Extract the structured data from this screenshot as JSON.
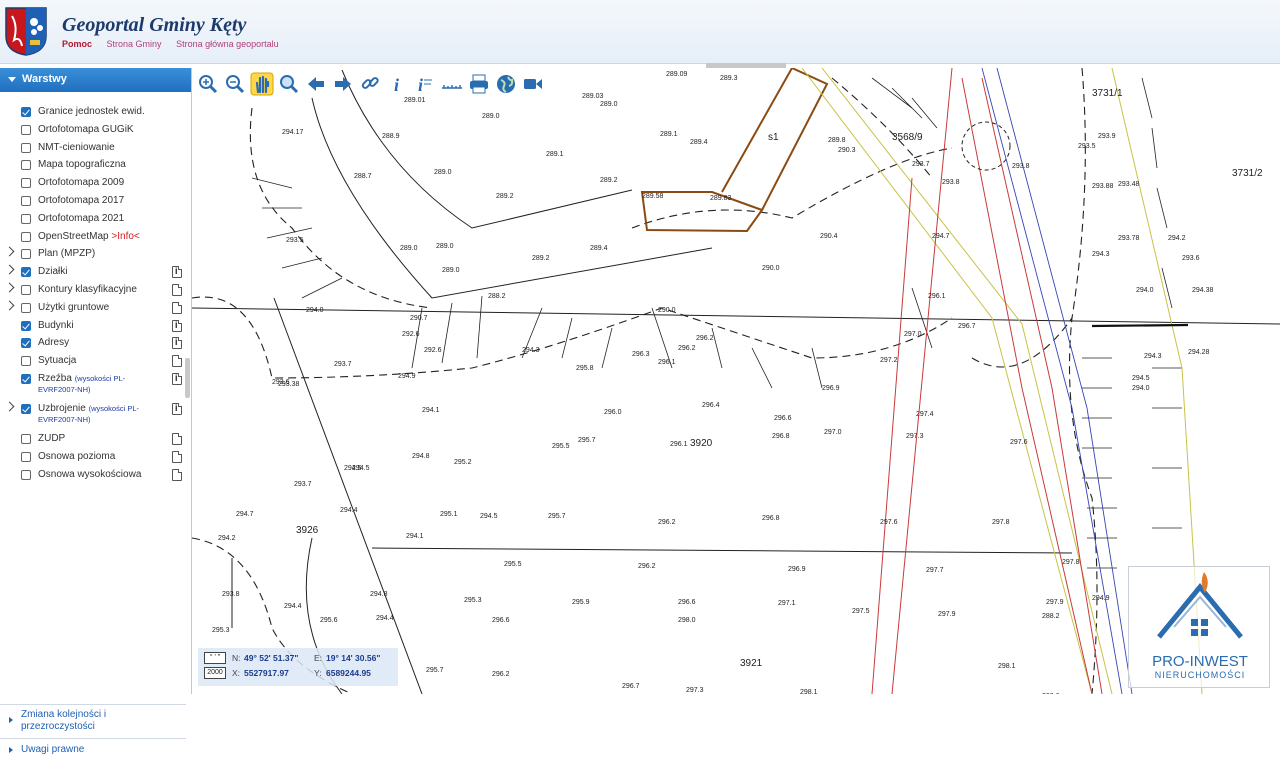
{
  "header": {
    "title": "Geoportal Gminy Kęty",
    "links": [
      "Pomoc",
      "Strona Gminy",
      "Strona główna geoportalu"
    ]
  },
  "sidebar": {
    "panel_title": "Warstwy",
    "layers": [
      {
        "label": "Granice jednostek ewid.",
        "checked": true,
        "expandable": false,
        "icon": null
      },
      {
        "label": "Ortofotomapa GUGiK",
        "checked": false,
        "expandable": false,
        "icon": null
      },
      {
        "label": "NMT-cieniowanie",
        "checked": false,
        "expandable": false,
        "icon": null
      },
      {
        "label": "Mapa topograficzna",
        "checked": false,
        "expandable": false,
        "icon": null
      },
      {
        "label": "Ortofotomapa 2009",
        "checked": false,
        "expandable": false,
        "icon": null
      },
      {
        "label": "Ortofotomapa 2017",
        "checked": false,
        "expandable": false,
        "icon": null
      },
      {
        "label": "Ortofotomapa 2021",
        "checked": false,
        "expandable": false,
        "icon": null
      },
      {
        "label": "OpenStreetMap",
        "extra": ">Info<",
        "checked": false,
        "expandable": false,
        "icon": null
      },
      {
        "label": "Plan (MPZP)",
        "checked": false,
        "expandable": true,
        "icon": null
      },
      {
        "label": "Działki",
        "checked": true,
        "expandable": true,
        "icon": "info-doc-icon"
      },
      {
        "label": "Kontury klasyfikacyjne",
        "checked": false,
        "expandable": true,
        "icon": "doc-icon"
      },
      {
        "label": "Użytki gruntowe",
        "checked": false,
        "expandable": true,
        "icon": "doc-icon"
      },
      {
        "label": "Budynki",
        "checked": true,
        "expandable": false,
        "icon": "info-doc-icon"
      },
      {
        "label": "Adresy",
        "checked": true,
        "expandable": false,
        "icon": "info-doc-icon"
      },
      {
        "label": "Sytuacja",
        "checked": false,
        "expandable": false,
        "icon": "doc-icon"
      },
      {
        "label": "Rzeźba",
        "sub": "(wysokości PL-EVRF2007-NH)",
        "checked": true,
        "expandable": false,
        "icon": "info-doc-icon"
      },
      {
        "label": "Uzbrojenie",
        "sub": "(wysokości PL-EVRF2007-NH)",
        "checked": true,
        "expandable": true,
        "icon": "info-doc-icon"
      },
      {
        "label": "ZUDP",
        "checked": false,
        "expandable": false,
        "icon": "doc-icon"
      },
      {
        "label": "Osnowa pozioma",
        "checked": false,
        "expandable": false,
        "icon": "doc-icon"
      },
      {
        "label": "Osnowa wysokościowa",
        "checked": false,
        "expandable": false,
        "icon": "doc-icon"
      }
    ],
    "order_panel": "Zmiana kolejności i przezroczystości",
    "legal_panel": "Uwagi prawne"
  },
  "toolbar": [
    "zoom-in-icon",
    "zoom-out-icon",
    "pan-hand-icon",
    "zoom-box-icon",
    "back-arrow-icon",
    "forward-arrow-icon",
    "link-icon",
    "info-icon",
    "info-query-icon",
    "measure-icon",
    "print-icon",
    "globe-icon",
    "video-icon"
  ],
  "coords": {
    "system_a": "° ' \"",
    "system_b": "2000",
    "n_label": "N:",
    "n_value": "49° 52' 51.37\"",
    "e_label": "E:",
    "e_value": "19° 14' 30.56\"",
    "x_label": "X:",
    "x_value": "5527917.97",
    "y_label": "Y:",
    "y_value": "6589244.95"
  },
  "map": {
    "parcels": [
      "3920",
      "3926",
      "3921",
      "3568/9",
      "3731/1",
      "3731/2",
      "s1",
      "3568/9.293.3"
    ],
    "heights": [
      "289.09",
      "289.3",
      "289.01",
      "289.03",
      "289.0",
      "289.0",
      "294.17",
      "288.9",
      "289.1",
      "289.4",
      "289.8",
      "290.3",
      "293.7",
      "288.7",
      "289.0",
      "289.1",
      "289.2",
      "289.58",
      "289.83",
      "293.8",
      "294.7",
      "289.0",
      "289.2",
      "289.4",
      "290.4",
      "293.5",
      "289.0",
      "289.0",
      "289.2",
      "290.0",
      "294.0",
      "288.2",
      "294.3",
      "290.7",
      "290.0",
      "296.1",
      "292.6",
      "292.6",
      "296.2",
      "296.2",
      "297.0",
      "294.5",
      "296.3",
      "296.7",
      "293.7",
      "294.9",
      "295.8",
      "296.1",
      "297.2",
      "293.6",
      "296.9",
      "294.1",
      "296.4",
      "296.0",
      "295.7",
      "296.6",
      "297.4",
      "295.5",
      "296.1",
      "296.8",
      "297.0",
      "297.3",
      "297.6",
      "294.8",
      "295.2",
      "294.5",
      "293.7",
      "294.7",
      "294.4",
      "295.1",
      "294.5",
      "295.7",
      "296.2",
      "296.8",
      "297.6",
      "297.8",
      "294.2",
      "294.1",
      "295.5",
      "296.2",
      "296.9",
      "297.7",
      "297.8",
      "293.8",
      "294.8",
      "294.4",
      "295.3",
      "295.9",
      "296.6",
      "297.1",
      "297.5",
      "297.9",
      "297.9",
      "294.9",
      "294.4",
      "295.6",
      "296.6",
      "298.0",
      "288.2",
      "295.3",
      "295.7",
      "296.2",
      "296.7",
      "297.3",
      "298.1",
      "298.1",
      "293.6",
      "293.38",
      "293.5",
      "293.9",
      "293.8",
      "293.48",
      "293.88",
      "293.78",
      "294.0",
      "294.38",
      "294.3",
      "294.28",
      "294.5",
      "294.0",
      "294.3",
      "294.2",
      "293.6"
    ],
    "layers_colors": {
      "parcel_line": "#222222",
      "building": "#8b4a12",
      "gas": "#c83a3a",
      "water": "#3446b5",
      "road_edge": "#c9c246"
    }
  },
  "watermark": {
    "name": "PRO-INWEST",
    "sub": "NIERUCHOMOŚCI"
  }
}
